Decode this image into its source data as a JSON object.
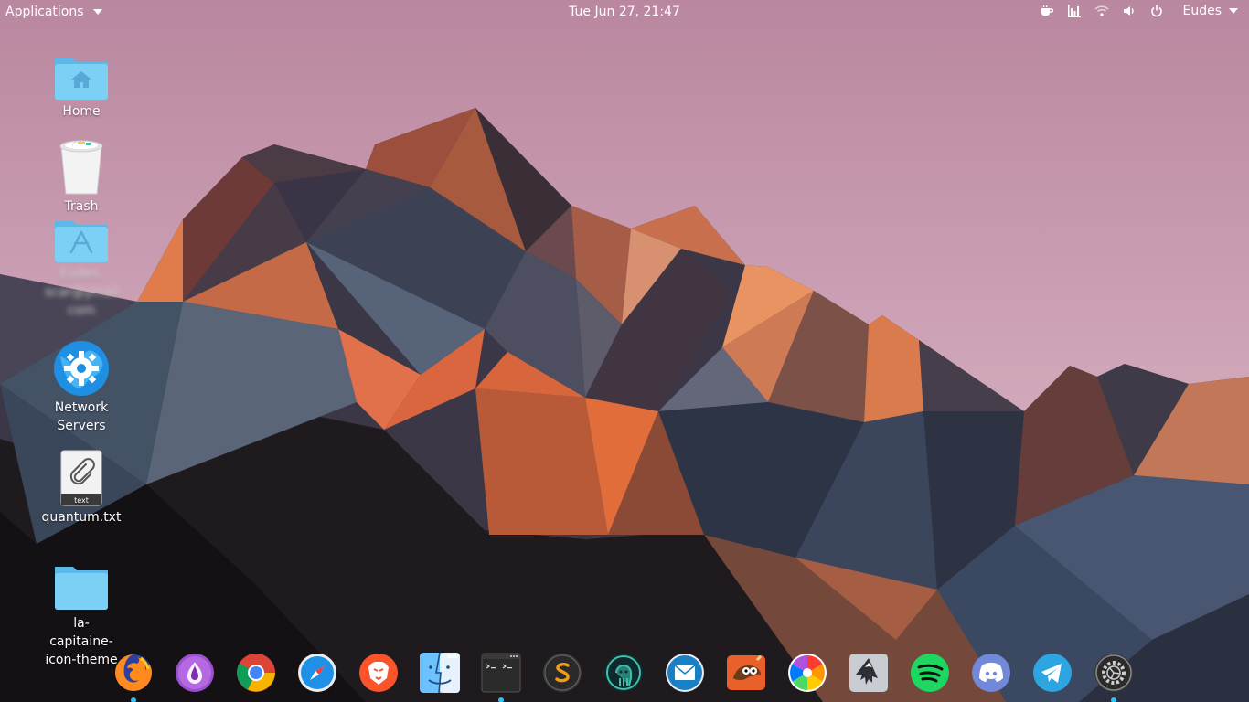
{
  "topbar": {
    "applications_label": "Applications",
    "clock": "Tue Jun 27, 21:47",
    "username": "Eudes",
    "tray_icons": [
      "coffee-icon",
      "bar-chart-icon",
      "wifi-icon",
      "volume-icon",
      "power-icon"
    ]
  },
  "desktop": {
    "icons": [
      {
        "name": "Home",
        "icon": "home-folder-icon"
      },
      {
        "name": "Trash",
        "icon": "trash-icon"
      },
      {
        "name": "Eudes. scar@ymail. com",
        "icon": "apps-folder-icon"
      },
      {
        "name": "Network Servers",
        "icon": "network-servers-icon"
      },
      {
        "name": "quantum.txt",
        "icon": "text-file-icon",
        "badge": "text"
      },
      {
        "name": "la-capitaine-icon-theme",
        "icon": "folder-icon"
      }
    ]
  },
  "dock": {
    "items": [
      {
        "name": "Firefox",
        "icon": "firefox-icon",
        "running": true
      },
      {
        "name": "Tor Browser",
        "icon": "tor-browser-icon",
        "running": false
      },
      {
        "name": "Chrome",
        "icon": "chrome-icon",
        "running": false
      },
      {
        "name": "Safari",
        "icon": "safari-compass-icon",
        "running": false
      },
      {
        "name": "Brave",
        "icon": "brave-lion-icon",
        "running": false
      },
      {
        "name": "Files",
        "icon": "finder-icon",
        "running": false
      },
      {
        "name": "Terminal",
        "icon": "terminal-icon",
        "running": true
      },
      {
        "name": "Sublime Text",
        "icon": "sublime-icon",
        "running": false
      },
      {
        "name": "GitKraken",
        "icon": "gitkraken-icon",
        "running": false
      },
      {
        "name": "Mail",
        "icon": "mail-icon",
        "running": false
      },
      {
        "name": "GIMP",
        "icon": "gimp-icon",
        "running": false
      },
      {
        "name": "Color Picker",
        "icon": "color-wheel-icon",
        "running": false
      },
      {
        "name": "Inkscape",
        "icon": "inkscape-icon",
        "running": false
      },
      {
        "name": "Spotify",
        "icon": "spotify-icon",
        "running": false
      },
      {
        "name": "Discord",
        "icon": "discord-icon",
        "running": false
      },
      {
        "name": "Telegram",
        "icon": "telegram-icon",
        "running": false
      },
      {
        "name": "System Settings",
        "icon": "settings-gear-icon",
        "running": true
      }
    ]
  },
  "colors": {
    "sky_top": "#b9879f",
    "sky_bottom": "#e3c0cf",
    "accent_running": "#2ec4f1",
    "folder_blue": "#7ccff5"
  }
}
